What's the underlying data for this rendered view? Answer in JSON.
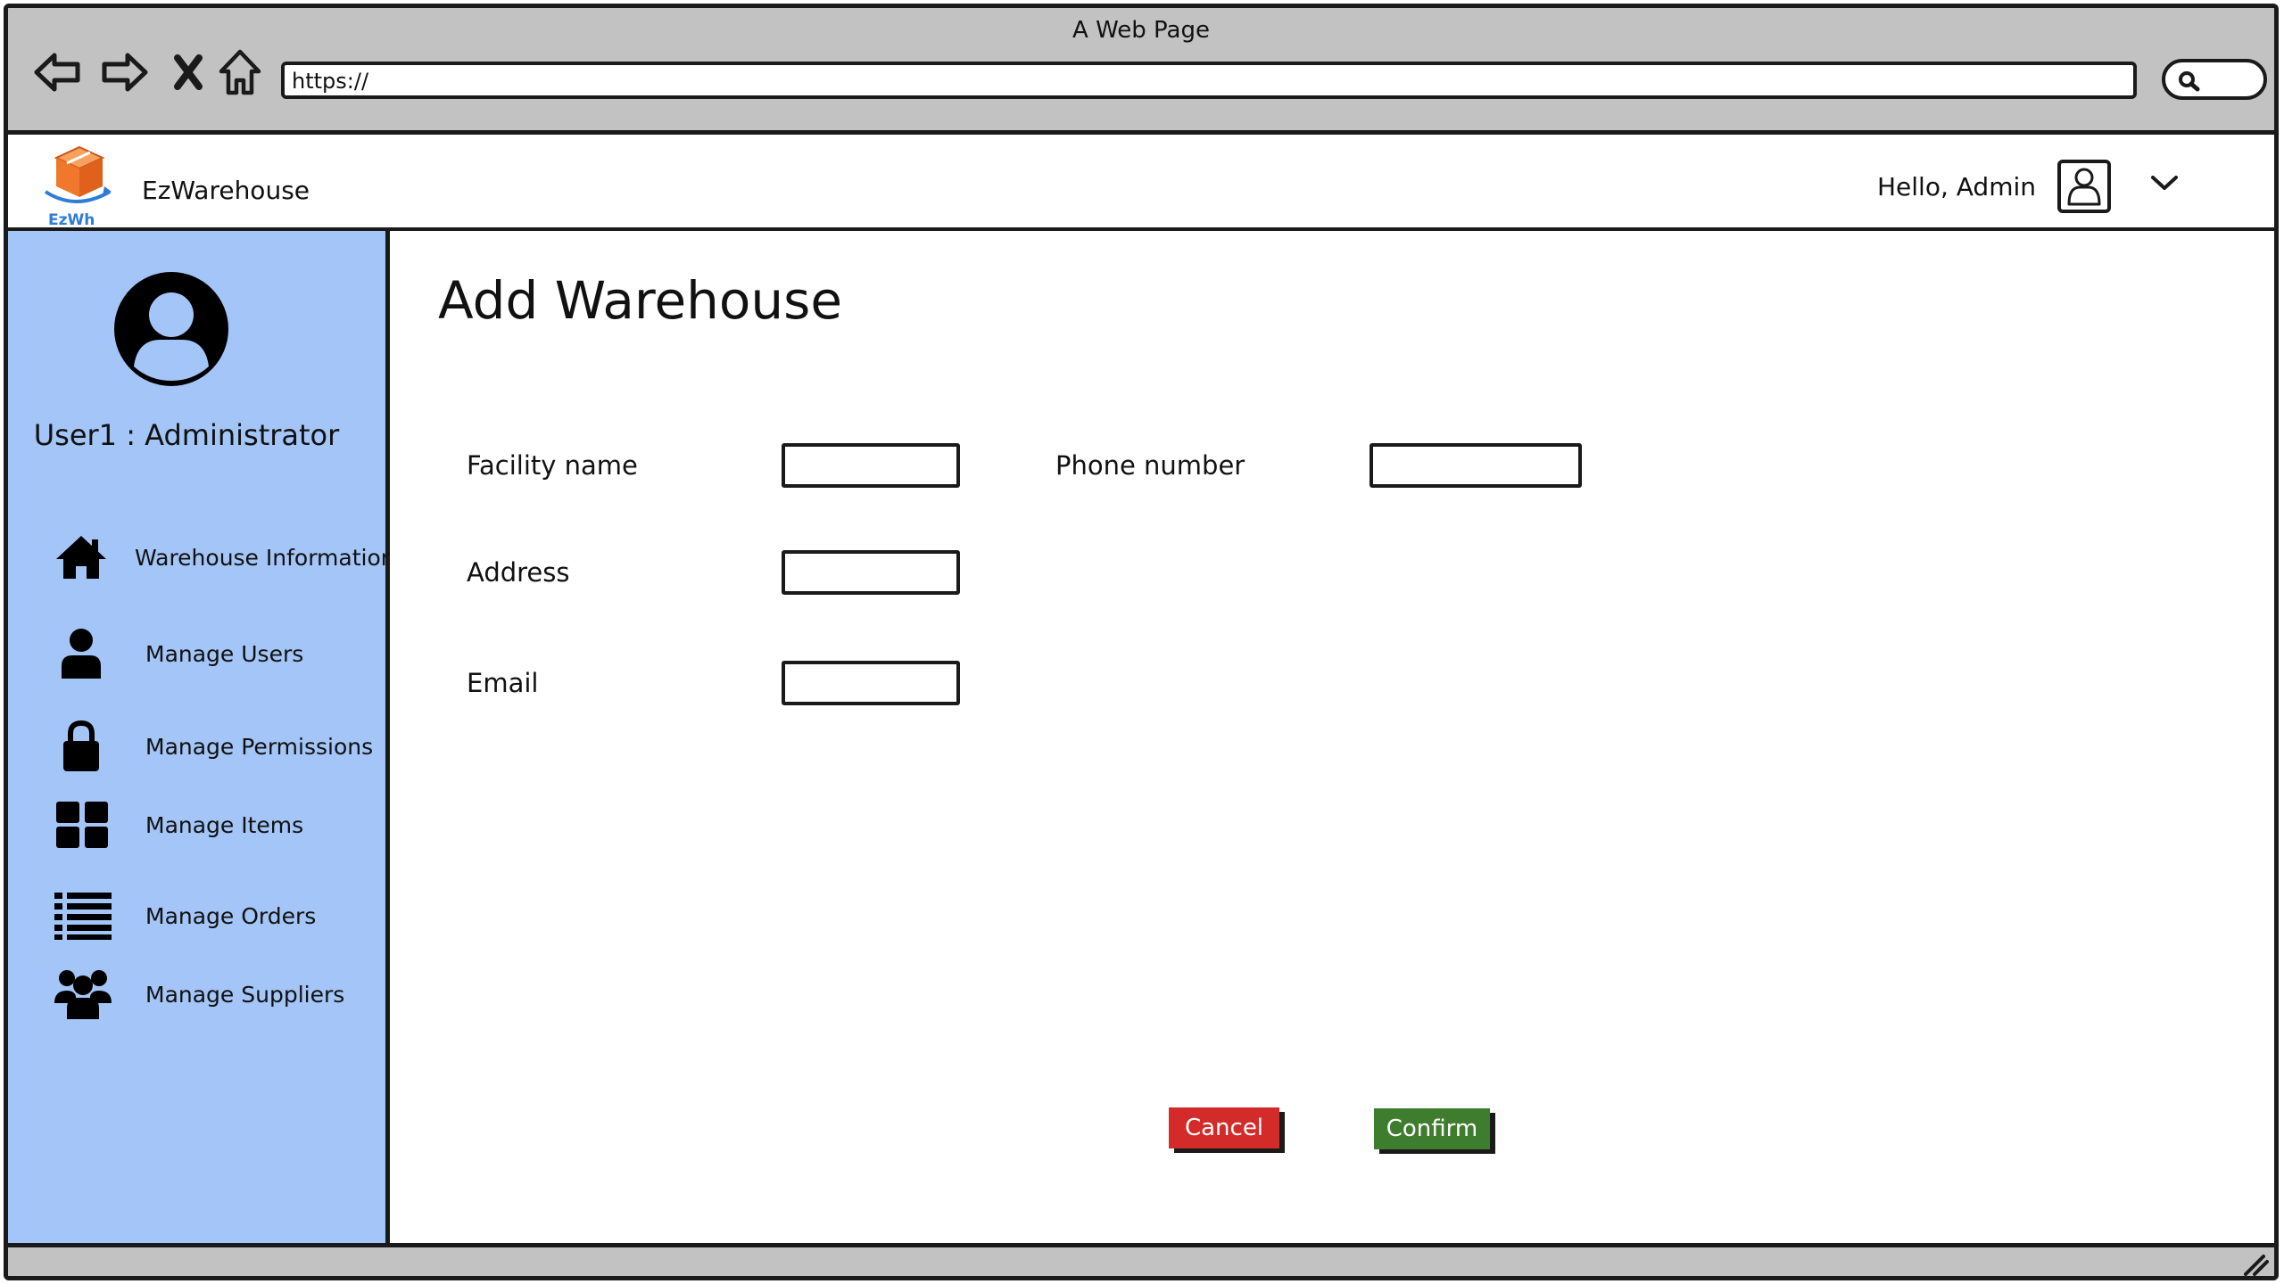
{
  "browser": {
    "window_title": "A Web Page",
    "url": "https://",
    "icons": [
      "back-icon",
      "forward-icon",
      "close-icon",
      "home-icon",
      "search-icon"
    ]
  },
  "header": {
    "logo_text": "EzWh",
    "brand": "EzWarehouse",
    "greeting": "Hello, Admin"
  },
  "sidebar": {
    "profile_name": "User1 : Administrator",
    "items": [
      {
        "label": "Warehouse Information",
        "icon": "home-icon"
      },
      {
        "label": "Manage Users",
        "icon": "user-icon"
      },
      {
        "label": "Manage Permissions",
        "icon": "lock-icon"
      },
      {
        "label": "Manage Items",
        "icon": "grid-icon"
      },
      {
        "label": "Manage Orders",
        "icon": "list-icon"
      },
      {
        "label": "Manage Suppliers",
        "icon": "users-group-icon"
      }
    ]
  },
  "main": {
    "title": "Add Warehouse",
    "fields": {
      "facility_name": {
        "label": "Facility name",
        "value": ""
      },
      "phone_number": {
        "label": "Phone number",
        "value": ""
      },
      "address": {
        "label": "Address",
        "value": ""
      },
      "email": {
        "label": "Email",
        "value": ""
      }
    },
    "cancel_label": "Cancel",
    "confirm_label": "Confirm"
  },
  "colors": {
    "chrome": "#c2c2c2",
    "sidebar": "#a3c5f7",
    "cancel": "#d32a2a",
    "confirm": "#3f7d2e",
    "logo_accent": "#2f7bd8",
    "logo_box": "#f0782d"
  }
}
